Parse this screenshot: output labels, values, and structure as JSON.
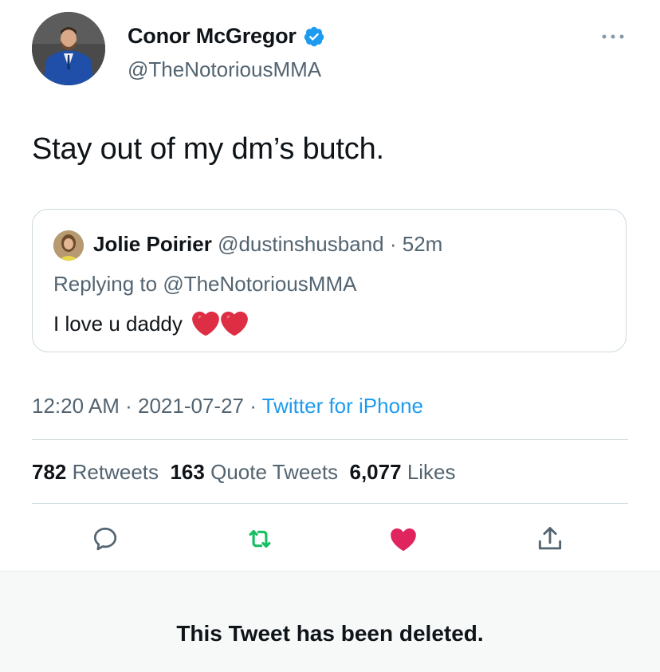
{
  "author": {
    "display_name": "Conor McGregor",
    "handle": "@TheNotoriousMMA",
    "verified": true,
    "avatar_icon": "profile-photo-man-blue-suit"
  },
  "tweet": {
    "text": "Stay out of my dm’s butch."
  },
  "quoted_tweet": {
    "display_name": "Jolie Poirier",
    "handle": "@dustinshusband",
    "separator": "·",
    "age": "52m",
    "replying_to_prefix": "Replying to ",
    "replying_to_handle": "@TheNotoriousMMA",
    "text": "I love u daddy",
    "emoji": [
      "red-heart",
      "red-heart"
    ]
  },
  "meta": {
    "time": "12:20 AM",
    "separator": "·",
    "date": "2021-07-27",
    "source": "Twitter for iPhone"
  },
  "stats": {
    "retweets_count": "782",
    "retweets_label": "Retweets",
    "quotes_count": "163",
    "quotes_label": "Quote Tweets",
    "likes_count": "6,077",
    "likes_label": "Likes"
  },
  "actions": {
    "reply_icon": "reply-icon",
    "retweet_icon": "retweet-icon",
    "like_icon": "heart-filled-icon",
    "share_icon": "share-icon"
  },
  "colors": {
    "link_blue": "#1d9bf0",
    "retweet_green": "#17bf63",
    "like_red": "#e0245e",
    "secondary_text": "#536471"
  },
  "banner": {
    "text": "This Tweet has been deleted."
  }
}
